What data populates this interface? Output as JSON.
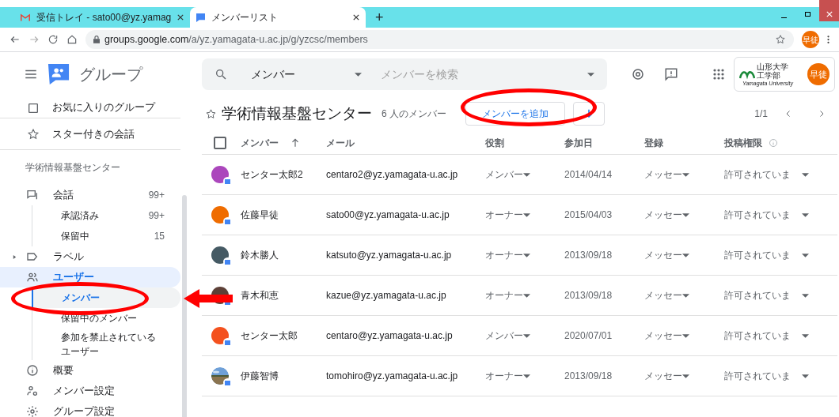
{
  "browser": {
    "tabs": [
      {
        "title": "受信トレイ - sato00@yz.yamag",
        "selected": false
      },
      {
        "title": "メンバーリスト",
        "selected": true
      }
    ],
    "new_tab": "+",
    "url_host": "groups.google.com",
    "url_path": "/a/yz.yamagata-u.ac.jp/g/yzcsc/members",
    "profile": "早徒"
  },
  "header": {
    "app_name": "グループ",
    "search_scope": "メンバー",
    "search_placeholder": "メンバーを検索",
    "org_name_1": "山形大学",
    "org_name_2": "工学部",
    "org_name_en": "Yamagata University",
    "account": "早徒"
  },
  "sidebar": {
    "items": [
      {
        "kind": "pinned",
        "label": "お気に入りのグループ"
      },
      {
        "kind": "pinned",
        "label": "スター付きの会話"
      },
      {
        "kind": "section",
        "label": "学術情報基盤センター"
      },
      {
        "kind": "link",
        "label": "会話",
        "count": "99+",
        "highlighted": false,
        "children": [
          {
            "label": "承認済み",
            "count": "99+",
            "selected": false
          },
          {
            "label": "保留中",
            "count": "15",
            "selected": false
          }
        ]
      },
      {
        "kind": "link",
        "label": "ラベル",
        "expanded": false,
        "highlighted": false
      },
      {
        "kind": "link",
        "label": "ユーザー",
        "highlighted": true,
        "children": [
          {
            "label": "メンバー",
            "selected": true
          },
          {
            "label": "保留中のメンバー",
            "selected": false
          },
          {
            "label": "参加を禁止されているユーザー",
            "selected": false
          }
        ]
      },
      {
        "kind": "link",
        "label": "概要",
        "highlighted": false
      },
      {
        "kind": "link",
        "label": "メンバー設定",
        "highlighted": false
      },
      {
        "kind": "link",
        "label": "グループ設定",
        "highlighted": false
      }
    ]
  },
  "group": {
    "title": "学術情報基盤センター",
    "starred": false,
    "member_count": "6 人のメンバー",
    "add_button": "メンバーを追加",
    "pager": "1/1"
  },
  "table": {
    "select_all_checked": false,
    "columns": [
      "メンバー",
      "メール",
      "役割",
      "参加日",
      "登録",
      "投稿権限"
    ],
    "rows": [
      {
        "avatar": {
          "kind": "initials",
          "color": "#ab47bc"
        },
        "name": "センター太郎2",
        "email": "centaro2@yz.yamagata-u.ac.jp",
        "role": "メンバー",
        "joined": "2014/04/14",
        "subscription": "メッセー",
        "posting": "許可されていま"
      },
      {
        "avatar": {
          "kind": "initials",
          "color": "#ef6c00"
        },
        "name": "佐藤早徒",
        "email": "sato00@yz.yamagata-u.ac.jp",
        "role": "オーナー",
        "joined": "2015/04/03",
        "subscription": "メッセー",
        "posting": "許可されていま"
      },
      {
        "avatar": {
          "kind": "initials",
          "color": "#455a64"
        },
        "name": "鈴木勝人",
        "email": "katsuto@yz.yamagata-u.ac.jp",
        "role": "オーナー",
        "joined": "2013/09/18",
        "subscription": "メッセー",
        "posting": "許可されていま"
      },
      {
        "avatar": {
          "kind": "initials",
          "color": "#5d4037"
        },
        "name": "青木和恵",
        "email": "kazue@yz.yamagata-u.ac.jp",
        "role": "オーナー",
        "joined": "2013/09/18",
        "subscription": "メッセー",
        "posting": "許可されていま"
      },
      {
        "avatar": {
          "kind": "initials",
          "color": "#f4511e"
        },
        "name": "センター太郎",
        "email": "centaro@yz.yamagata-u.ac.jp",
        "role": "メンバー",
        "joined": "2020/07/01",
        "subscription": "メッセー",
        "posting": "許可されていま"
      },
      {
        "name": "伊藤智博",
        "email": "tomohiro@yz.yamagata-u.ac.jp",
        "role": "オーナー",
        "joined": "2013/09/18",
        "subscription": "メッセー",
        "posting": "許可されていま"
      }
    ]
  },
  "annotations": [
    {
      "kind": "ellipse"
    },
    {
      "kind": "ellipse"
    },
    {
      "kind": "arrow"
    }
  ]
}
